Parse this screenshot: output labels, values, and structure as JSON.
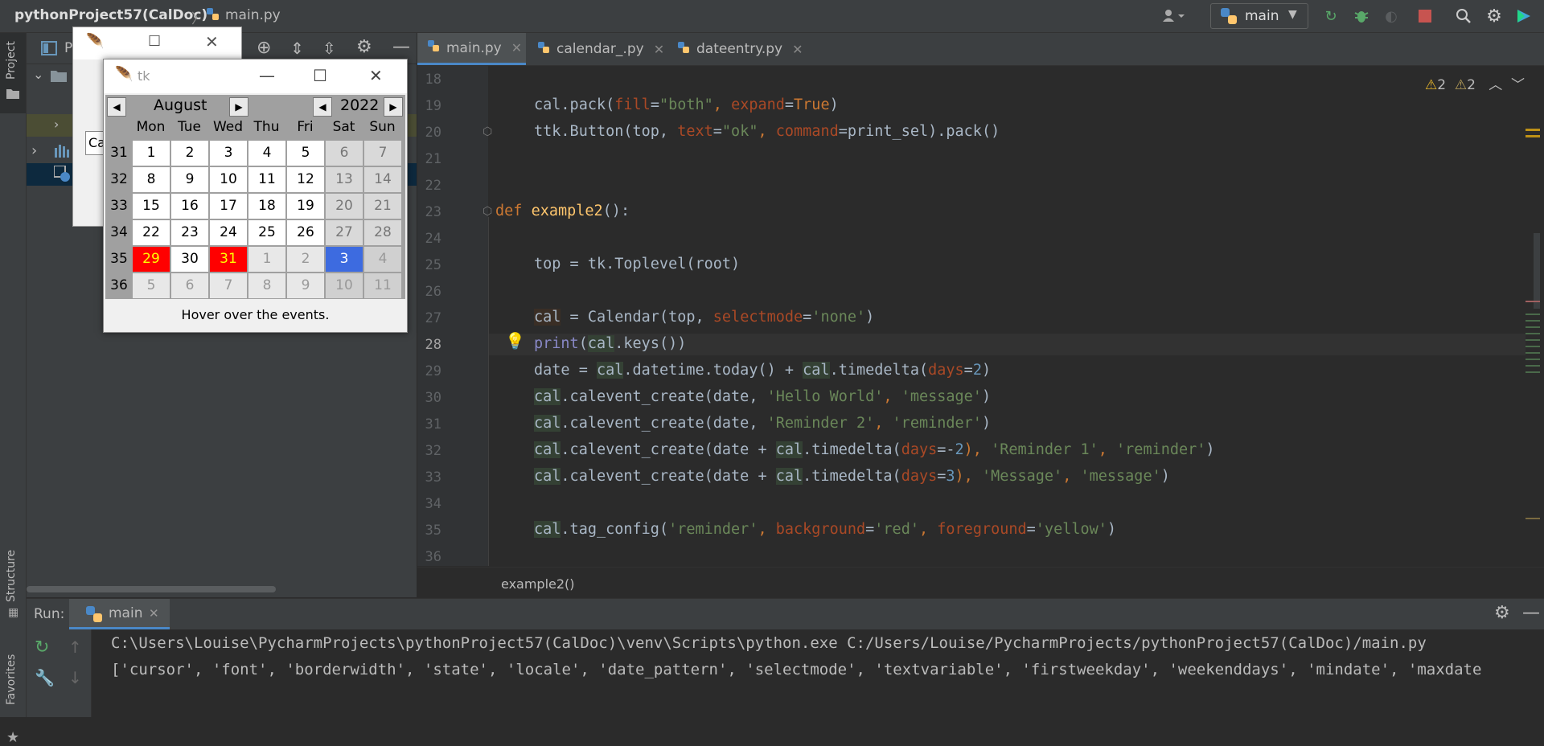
{
  "titlebar": {
    "project": "pythonProject57(CalDoc)",
    "separator": "〉",
    "file": "main.py",
    "run_config": "main"
  },
  "left_stripe": {
    "project": "Project",
    "structure": "Structure",
    "favorites": "Favorites"
  },
  "tabs": [
    {
      "label": "main.py",
      "active": true
    },
    {
      "label": "calendar_.py",
      "active": false
    },
    {
      "label": "dateentry.py",
      "active": false
    }
  ],
  "inspections": {
    "warnings_a": "2",
    "warnings_b": "2"
  },
  "breadcrumb": "example2()",
  "run": {
    "label": "Run:",
    "tab": "main",
    "output_line1": "C:\\Users\\Louise\\PycharmProjects\\pythonProject57(CalDoc)\\venv\\Scripts\\python.exe C:/Users/Louise/PycharmProjects/pythonProject57(CalDoc)/main.py",
    "output_line2": "['cursor', 'font', 'borderwidth', 'state', 'locale', 'date_pattern', 'selectmode', 'textvariable', 'firstweekday', 'weekenddays', 'mindate', 'maxdate"
  },
  "project_partial": {
    "p": "P",
    "ca": "Ca"
  },
  "tk": {
    "title": "tk",
    "month": "August",
    "year": "2022",
    "day_headers": [
      "Mon",
      "Tue",
      "Wed",
      "Thu",
      "Fri",
      "Sat",
      "Sun"
    ],
    "weeks": [
      "31",
      "32",
      "33",
      "34",
      "35",
      "36"
    ],
    "days": [
      [
        "1",
        "2",
        "3",
        "4",
        "5",
        "6",
        "7"
      ],
      [
        "8",
        "9",
        "10",
        "11",
        "12",
        "13",
        "14"
      ],
      [
        "15",
        "16",
        "17",
        "18",
        "19",
        "20",
        "21"
      ],
      [
        "22",
        "23",
        "24",
        "25",
        "26",
        "27",
        "28"
      ],
      [
        "29",
        "30",
        "31",
        "1",
        "2",
        "3",
        "4"
      ],
      [
        "5",
        "6",
        "7",
        "8",
        "9",
        "10",
        "11"
      ]
    ],
    "status": "Hover over the events."
  },
  "line_numbers": [
    "18",
    "19",
    "20",
    "21",
    "22",
    "23",
    "24",
    "25",
    "26",
    "27",
    "28",
    "29",
    "30",
    "31",
    "32",
    "33",
    "34",
    "35",
    "36"
  ],
  "code": {
    "l19": [
      "cal.pack(",
      "fill",
      "=",
      "\"both\"",
      ", ",
      "expand",
      "=",
      "True",
      ")"
    ],
    "l20": [
      "ttk.Button(top, ",
      "text",
      "=",
      "\"ok\"",
      ", ",
      "command",
      "=print_sel).pack()"
    ],
    "l23": [
      "def ",
      "example2",
      "():"
    ],
    "l25": [
      "top = tk.Toplevel(root)"
    ],
    "l27": [
      "cal",
      " = Calendar(top, ",
      "selectmode",
      "=",
      "'none'",
      ")"
    ],
    "l28": [
      "print",
      "(",
      "cal",
      ".keys())"
    ],
    "l29": [
      "date = ",
      "cal",
      ".datetime.today() + ",
      "cal",
      ".timedelta(",
      "days",
      "=",
      "2",
      ")"
    ],
    "l30": [
      "cal",
      ".calevent_create(date, ",
      "'Hello World'",
      ", ",
      "'message'",
      ")"
    ],
    "l31": [
      "cal",
      ".calevent_create(date, ",
      "'Reminder 2'",
      ", ",
      "'reminder'",
      ")"
    ],
    "l32": [
      "cal",
      ".calevent_create(date + ",
      "cal",
      ".timedelta(",
      "days",
      "=-",
      "2",
      "), ",
      "'Reminder 1'",
      ", ",
      "'reminder'",
      ")"
    ],
    "l33": [
      "cal",
      ".calevent_create(date + ",
      "cal",
      ".timedelta(",
      "days",
      "=",
      "3",
      "), ",
      "'Message'",
      ", ",
      "'message'",
      ")"
    ],
    "l35": [
      "cal",
      ".tag_config(",
      "'reminder'",
      ", ",
      "background",
      "=",
      "'red'",
      ", ",
      "foreground",
      "=",
      "'yellow'",
      ")"
    ]
  },
  "colors": {
    "keyword": "#cc7832",
    "function": "#ffc66d",
    "string": "#6a8759",
    "param": "#aa4926",
    "number": "#6897bb",
    "event_bg": "#ff0000",
    "event_fg": "#ffff00",
    "selected": "#3d6be0"
  }
}
